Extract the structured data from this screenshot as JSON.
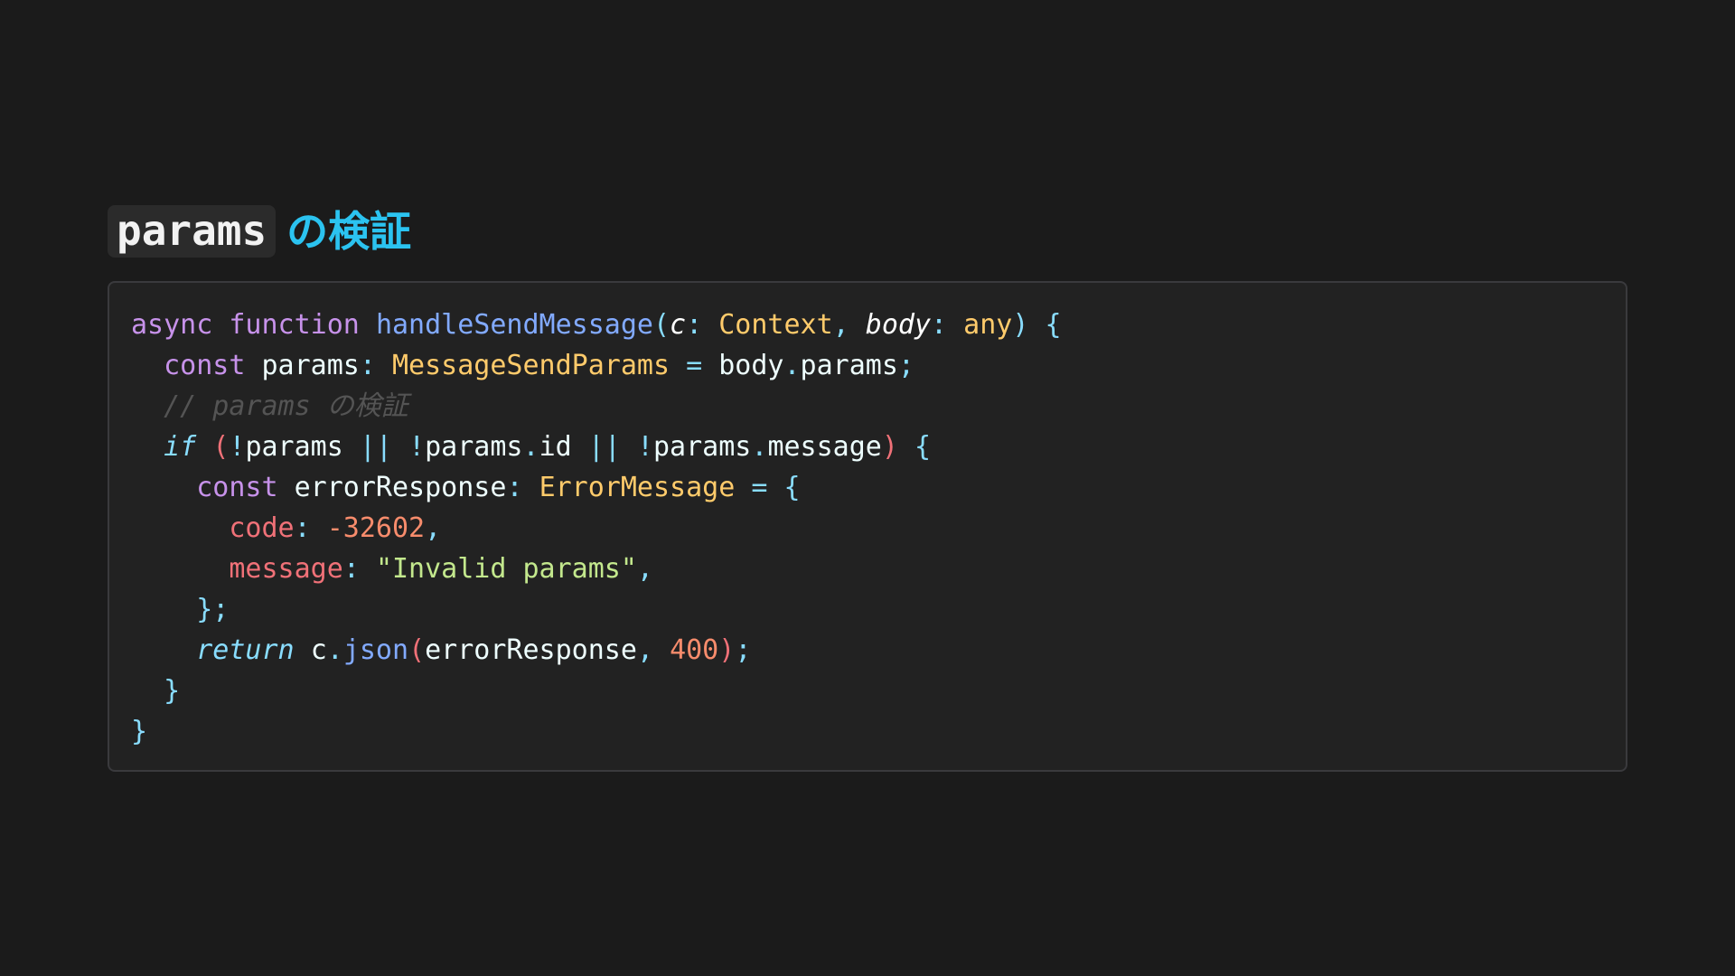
{
  "heading": {
    "code": "params",
    "text": "の検証"
  },
  "code": {
    "line1": {
      "async": "async",
      "function": "function",
      "name": "handleSendMessage",
      "open": "(",
      "param1": "c",
      "colon1": ":",
      "type1": "Context",
      "comma1": ",",
      "param2": "body",
      "colon2": ":",
      "type2": "any",
      "close": ")",
      "brace": "{"
    },
    "line2": {
      "const": "const",
      "name": "params",
      "colon": ":",
      "type": "MessageSendParams",
      "eq": "=",
      "obj": "body",
      "dot": ".",
      "prop": "params",
      "semi": ";"
    },
    "line3": {
      "comment": "// params の検証"
    },
    "line4": {
      "if": "if",
      "open": "(",
      "not1": "!",
      "v1": "params",
      "or1": "||",
      "not2": "!",
      "v2": "params",
      "dot2": ".",
      "p2": "id",
      "or2": "||",
      "not3": "!",
      "v3": "params",
      "dot3": ".",
      "p3": "message",
      "close": ")",
      "brace": "{"
    },
    "line5": {
      "const": "const",
      "name": "errorResponse",
      "colon": ":",
      "type": "ErrorMessage",
      "eq": "=",
      "brace": "{"
    },
    "line6": {
      "key": "code",
      "colon": ":",
      "value": "-32602",
      "comma": ","
    },
    "line7": {
      "key": "message",
      "colon": ":",
      "value": "\"Invalid params\"",
      "comma": ","
    },
    "line8": {
      "close": "};"
    },
    "line9": {
      "return": "return",
      "obj": "c",
      "dot": ".",
      "method": "json",
      "open": "(",
      "arg1": "errorResponse",
      "comma": ",",
      "arg2": "400",
      "close": ")",
      "semi": ";"
    },
    "line10": {
      "close": "}"
    },
    "line11": {
      "close": "}"
    }
  }
}
